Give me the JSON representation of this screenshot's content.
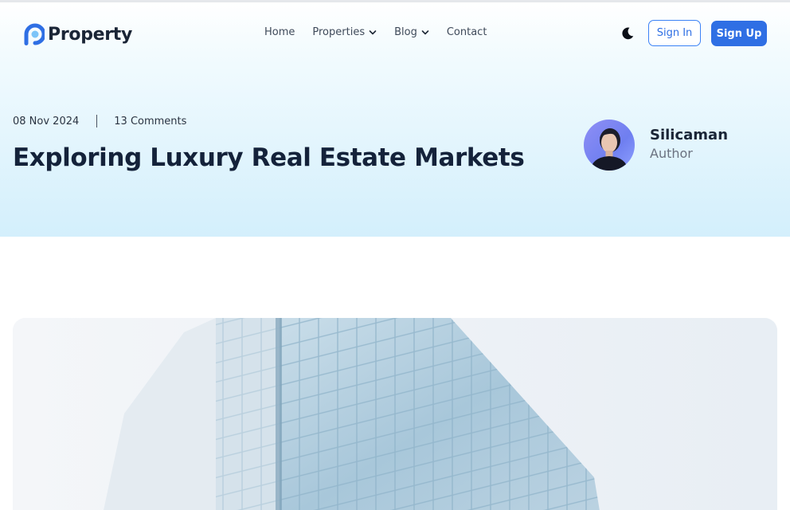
{
  "brand": {
    "name": "Property",
    "accent": "#2f6fe4"
  },
  "nav": {
    "items": [
      {
        "label": "Home",
        "has_dropdown": false
      },
      {
        "label": "Properties",
        "has_dropdown": true
      },
      {
        "label": "Blog",
        "has_dropdown": true
      },
      {
        "label": "Contact",
        "has_dropdown": false
      }
    ]
  },
  "header": {
    "theme_icon": "moon-icon",
    "signin_label": "Sign In",
    "signup_label": "Sign Up"
  },
  "post": {
    "date": "08 Nov 2024",
    "comments": "13 Comments",
    "title": "Exploring Luxury Real Estate Markets",
    "author": {
      "name": "Silicaman",
      "role": "Author"
    }
  },
  "colors": {
    "hero_gradient_end": "#d3effc",
    "heading": "#14223a"
  }
}
